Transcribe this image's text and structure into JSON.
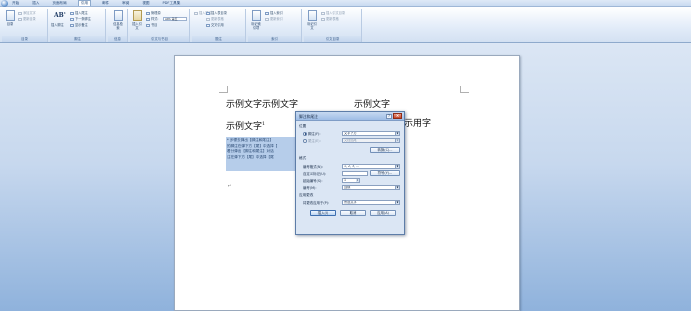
{
  "tabs": [
    "开始",
    "插入",
    "页面布局",
    "引用",
    "邮件",
    "审阅",
    "视图",
    "PDF工具集"
  ],
  "active_tab": "引用",
  "ribbon": {
    "toc_group": {
      "big": "目录",
      "add_text": "添加文字",
      "update_toc": "更新目录",
      "label": "目录"
    },
    "footnote_group": {
      "insert_footnote": "插入脚注",
      "insert_endnote": "插入尾注",
      "next_footnote": "下一条脚注",
      "show_notes": "显示备注",
      "label": "脚注"
    },
    "research_group": {
      "big": "信息检索",
      "label": "信息"
    },
    "citation_group": {
      "insert_citation": "插入引文",
      "manage_sources": "管理源",
      "style_label": "样式:",
      "style_value": "APA 第五",
      "bibliography": "书目",
      "label": "引文与书目"
    },
    "caption_group": {
      "insert_caption": "插入题注",
      "insert_table_of_figures": "插入表目录",
      "update_table": "更新表格",
      "cross_reference": "交叉引用",
      "label": "题注"
    },
    "index_group": {
      "mark_entry": "标记索引项",
      "insert_index": "插入索引",
      "update_index": "更新索引",
      "label": "索引"
    },
    "toa_group": {
      "mark_citation": "标记引文",
      "insert_toa": "插入引文目录",
      "update_toa": "更新表格",
      "label": "引文目录"
    }
  },
  "document": {
    "line1_left": "示例文字示例文字",
    "line1_right": "示例文字",
    "line2_left": "示例文字",
    "line2_superscript": "1",
    "line2_right": "示用字",
    "footnote_lines": [
      "* 步骤去弹出【脚注和尾注】",
      "的脚注在弹下方【尾】中选择【",
      "看分弹出【脚注和尾注】对话",
      "注在弹下方【尾】中选择【尾"
    ]
  },
  "dialog": {
    "title": "脚注和尾注",
    "close_glyph": "×",
    "help_glyph": "?",
    "location_section": "位置",
    "footnote_radio": "脚注(F):",
    "footnote_position": "文字下方",
    "endnote_radio": "尾注(E):",
    "endnote_position": "文档结尾",
    "convert_button": "转换(C)...",
    "format_section": "格式",
    "number_format_label": "编号格式(N):",
    "number_format_value": "1, 2, 3, ...",
    "custom_mark_label": "自定义标记(U):",
    "symbol_button": "符号(Y)...",
    "start_at_label": "起始编号(S):",
    "start_at_value": "1",
    "numbering_label": "编号(M):",
    "numbering_value": "连续",
    "apply_section": "应用更改",
    "apply_to_label": "将更改应用于(P):",
    "apply_to_value": "所选文字",
    "insert_button": "插入(I)",
    "cancel_button": "取消",
    "apply_button": "应用(A)"
  }
}
